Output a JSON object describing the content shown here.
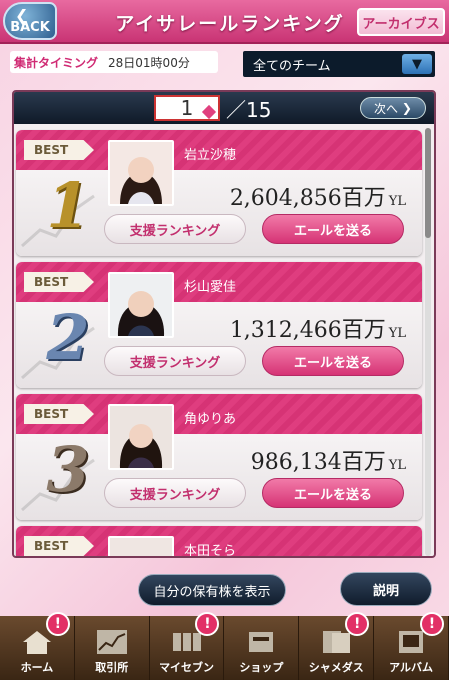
{
  "header": {
    "back_label": "BACK",
    "title": "アイサレールランキング",
    "archive_label": "アーカイブス"
  },
  "timing": {
    "label": "集計タイミング",
    "value": "28日01時00分"
  },
  "team_select": {
    "selected": "全てのチーム"
  },
  "pager": {
    "current": "1",
    "total": "／15",
    "next_label": "次へ"
  },
  "ranking": [
    {
      "badge": "BEST",
      "rank": "1",
      "name": "岩立沙穂",
      "amount": "2,604,856百万",
      "unit": "YL",
      "support_label": "支援ランキング",
      "yell_label": "エールを送る"
    },
    {
      "badge": "BEST",
      "rank": "2",
      "name": "杉山愛佳",
      "amount": "1,312,466百万",
      "unit": "YL",
      "support_label": "支援ランキング",
      "yell_label": "エールを送る"
    },
    {
      "badge": "BEST",
      "rank": "3",
      "name": "角ゆりあ",
      "amount": "986,134百万",
      "unit": "YL",
      "support_label": "支援ランキング",
      "yell_label": "エールを送る"
    },
    {
      "badge": "BEST",
      "rank": "",
      "name": "本田そら",
      "amount": "",
      "unit": "",
      "support_label": "",
      "yell_label": ""
    }
  ],
  "actions": {
    "holdings_label": "自分の保有株を表示",
    "help_label": "説明"
  },
  "tabbar": [
    {
      "label": "ホーム",
      "icon": "home-icon",
      "alert": "!"
    },
    {
      "label": "取引所",
      "icon": "chart-icon",
      "alert": ""
    },
    {
      "label": "マイセブン",
      "icon": "seats-icon",
      "alert": "!"
    },
    {
      "label": "ショップ",
      "icon": "shop-icon",
      "alert": ""
    },
    {
      "label": "シャメダス",
      "icon": "photo-icon",
      "alert": "!"
    },
    {
      "label": "アルバム",
      "icon": "album-icon",
      "alert": "!"
    }
  ],
  "colors": {
    "accent_pink": "#d63375",
    "header_pink": "#c93474",
    "navy": "#0f1a28"
  }
}
